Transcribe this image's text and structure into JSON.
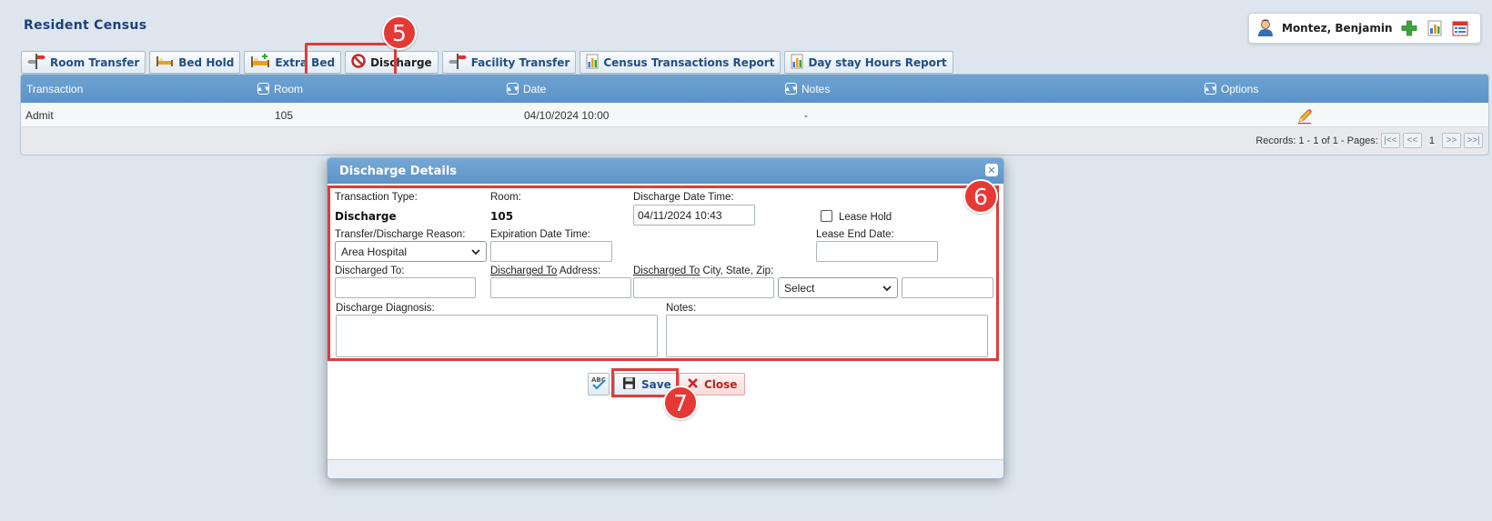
{
  "page": {
    "title": "Resident Census"
  },
  "user": {
    "name": "Montez, Benjamin"
  },
  "toolbar": {
    "room_transfer": "Room Transfer",
    "bed_hold": "Bed Hold",
    "extra_bed": "Extra Bed",
    "discharge": "Discharge",
    "facility_transfer": "Facility Transfer",
    "census_report": "Census Transactions Report",
    "daystay_report": "Day stay Hours Report"
  },
  "steps": {
    "five": "5",
    "six": "6",
    "seven": "7"
  },
  "grid": {
    "headers": {
      "transaction": "Transaction",
      "room": "Room",
      "date": "Date",
      "notes": "Notes",
      "options": "Options"
    },
    "rows": [
      {
        "transaction": "Admit",
        "room": "105",
        "date": "04/10/2024 10:00",
        "notes": "-"
      }
    ],
    "records": "Records: 1 - 1 of 1 - Pages:",
    "page": "1"
  },
  "dialog": {
    "title": "Discharge Details",
    "transaction_type_label": "Transaction Type:",
    "transaction_type_value": "Discharge",
    "room_label": "Room:",
    "room_value": "105",
    "discharge_dt_label": "Discharge Date Time:",
    "discharge_dt_value": "04/11/2024 10:43",
    "lease_hold_label": "Lease Hold",
    "reason_label": "Transfer/Discharge Reason:",
    "reason_value": "Area Hospital",
    "expiration_label": "Expiration Date Time:",
    "lease_end_label": "Lease End Date:",
    "discharged_to_label": "Discharged To:",
    "addr_label_u": "Discharged To",
    "addr_label_rest": " Address:",
    "city_label_u": "Discharged To",
    "city_label_rest": " City, State, Zip:",
    "state_value": "Select",
    "diagnosis_label": "Discharge Diagnosis:",
    "notes_label": "Notes:",
    "save_label": "Save",
    "close_label": "Close"
  },
  "colors": {
    "header_blue": "#5b93c8",
    "highlight_red": "#e23a3a",
    "title_navy": "#1f3f7a"
  }
}
